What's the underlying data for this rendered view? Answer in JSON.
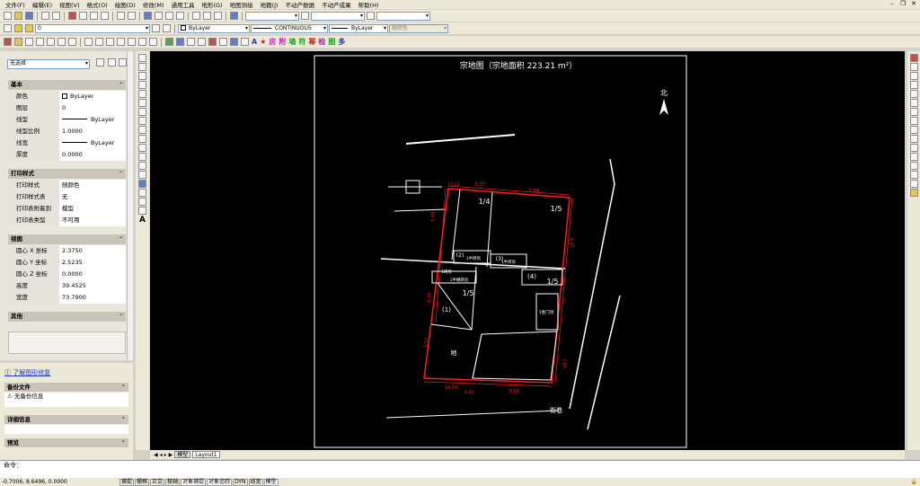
{
  "menu": {
    "items": [
      "文件(F)",
      "编辑(E)",
      "视图(V)",
      "格式(O)",
      "绘图(D)",
      "修改(M)",
      "通用工具",
      "地形(G)",
      "地图测绘",
      "地籍(J)",
      "不动产数据",
      "不动产成果",
      "帮助(H)"
    ]
  },
  "toolbar": {
    "layer_name": "0",
    "color": "ByLayer",
    "linetype": "CONTINUOUS",
    "lineweight": "ByLayer",
    "plotstyle": "随颜色"
  },
  "properties": {
    "selection": "无选择",
    "sections": {
      "basic": {
        "title": "基本",
        "rows": [
          {
            "k": "颜色",
            "v": "ByLayer"
          },
          {
            "k": "图层",
            "v": "0"
          },
          {
            "k": "线型",
            "v": "ByLayer"
          },
          {
            "k": "线型比例",
            "v": "1.0000"
          },
          {
            "k": "线宽",
            "v": "ByLayer"
          },
          {
            "k": "厚度",
            "v": "0.0000"
          }
        ]
      },
      "print": {
        "title": "打印样式",
        "rows": [
          {
            "k": "打印样式",
            "v": "随颜色"
          },
          {
            "k": "打印样式表",
            "v": "无"
          },
          {
            "k": "打印表附着到",
            "v": "模型"
          },
          {
            "k": "打印表类型",
            "v": "不可用"
          }
        ]
      },
      "view": {
        "title": "视图",
        "rows": [
          {
            "k": "圆心 X 坐标",
            "v": "2.3750"
          },
          {
            "k": "圆心 Y 坐标",
            "v": "2.5235"
          },
          {
            "k": "圆心 Z 坐标",
            "v": "0.0000"
          },
          {
            "k": "高度",
            "v": "39.4525"
          },
          {
            "k": "宽度",
            "v": "73.7900"
          }
        ]
      },
      "other": {
        "title": "其他"
      }
    }
  },
  "panel2": {
    "link": "了解图形修复",
    "backup_title": "备份文件",
    "backup_info": "无备份信息",
    "details_title": "详细信息",
    "preview_title": "预览"
  },
  "drawing": {
    "title": "宗地图（宗地面积  223.21 m²）",
    "north": "北",
    "road": "街巷",
    "labels": {
      "f14a": "1/4",
      "f15a": "1/5",
      "f15b": "1/5",
      "f15c": "1/5",
      "p1": "(1)",
      "p2": "(2)",
      "p3": "(3)",
      "p4": "(4)",
      "b1": "1半砖房",
      "b2": "1半砖房",
      "b3": "1砖房",
      "b4": "1半棚砖房",
      "gate": "1金门顶",
      "lot": "地"
    },
    "dims": {
      "d1": "3.77",
      "d2": "7.84",
      "d3": "8.45",
      "d4": "7.86",
      "d5": "5.19",
      "d6": "8.40",
      "d7": "5.52",
      "d8": "14.54",
      "d9": "3.69",
      "d10": "11.02",
      "d11": "8.10"
    }
  },
  "tabs": {
    "model": "模型",
    "layout1": "Layout1"
  },
  "cmd": {
    "prompt": "命令："
  },
  "status": {
    "coord": "-0.7006, 8.6496, 0.0000",
    "buttons": [
      "捕捉",
      "栅格",
      "正交",
      "极轴",
      "对象捕捉",
      "对象追踪",
      "DYN",
      "线宽",
      "模型"
    ]
  }
}
